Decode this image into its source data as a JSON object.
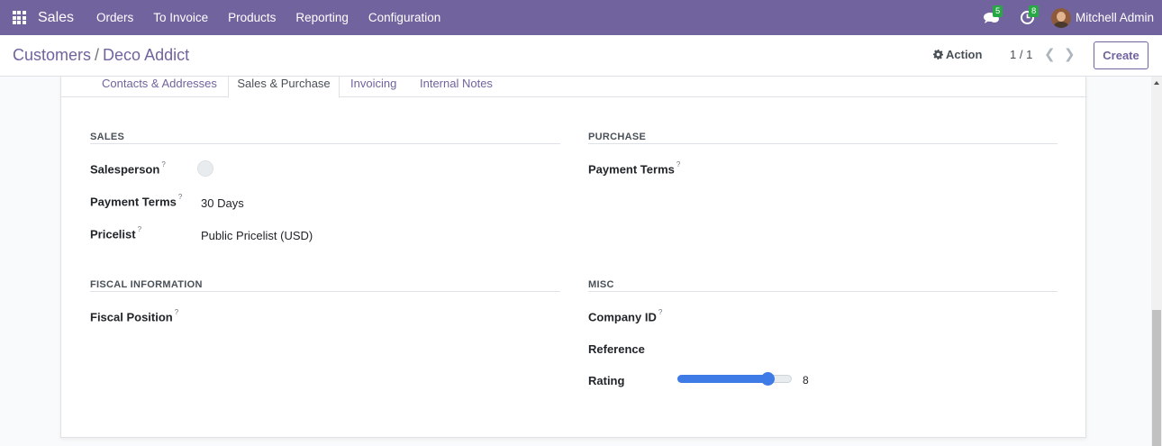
{
  "navbar": {
    "brand": "Sales",
    "menu": [
      "Orders",
      "To Invoice",
      "Products",
      "Reporting",
      "Configuration"
    ],
    "messages_badge": "5",
    "activities_badge": "8",
    "user_name": "Mitchell Admin",
    "accent_color": "#71639e"
  },
  "control_panel": {
    "breadcrumb_parent": "Customers",
    "breadcrumb_sep": "/",
    "breadcrumb_current": "Deco Addict",
    "action_label": "Action",
    "pager": "1 / 1",
    "create_label": "Create"
  },
  "tabs": [
    "Contacts & Addresses",
    "Sales & Purchase",
    "Invoicing",
    "Internal Notes"
  ],
  "active_tab": "Sales & Purchase",
  "sales": {
    "title": "SALES",
    "salesperson_label": "Salesperson",
    "payment_terms_label": "Payment Terms",
    "payment_terms_value": "30 Days",
    "pricelist_label": "Pricelist",
    "pricelist_value": "Public Pricelist (USD)"
  },
  "purchase": {
    "title": "PURCHASE",
    "payment_terms_label": "Payment Terms"
  },
  "fiscal": {
    "title": "FISCAL INFORMATION",
    "fiscal_position_label": "Fiscal Position"
  },
  "misc": {
    "title": "MISC",
    "company_id_label": "Company ID",
    "reference_label": "Reference",
    "rating_label": "Rating",
    "rating_value": "8",
    "rating_fraction": 0.8
  },
  "help_mark": "?"
}
